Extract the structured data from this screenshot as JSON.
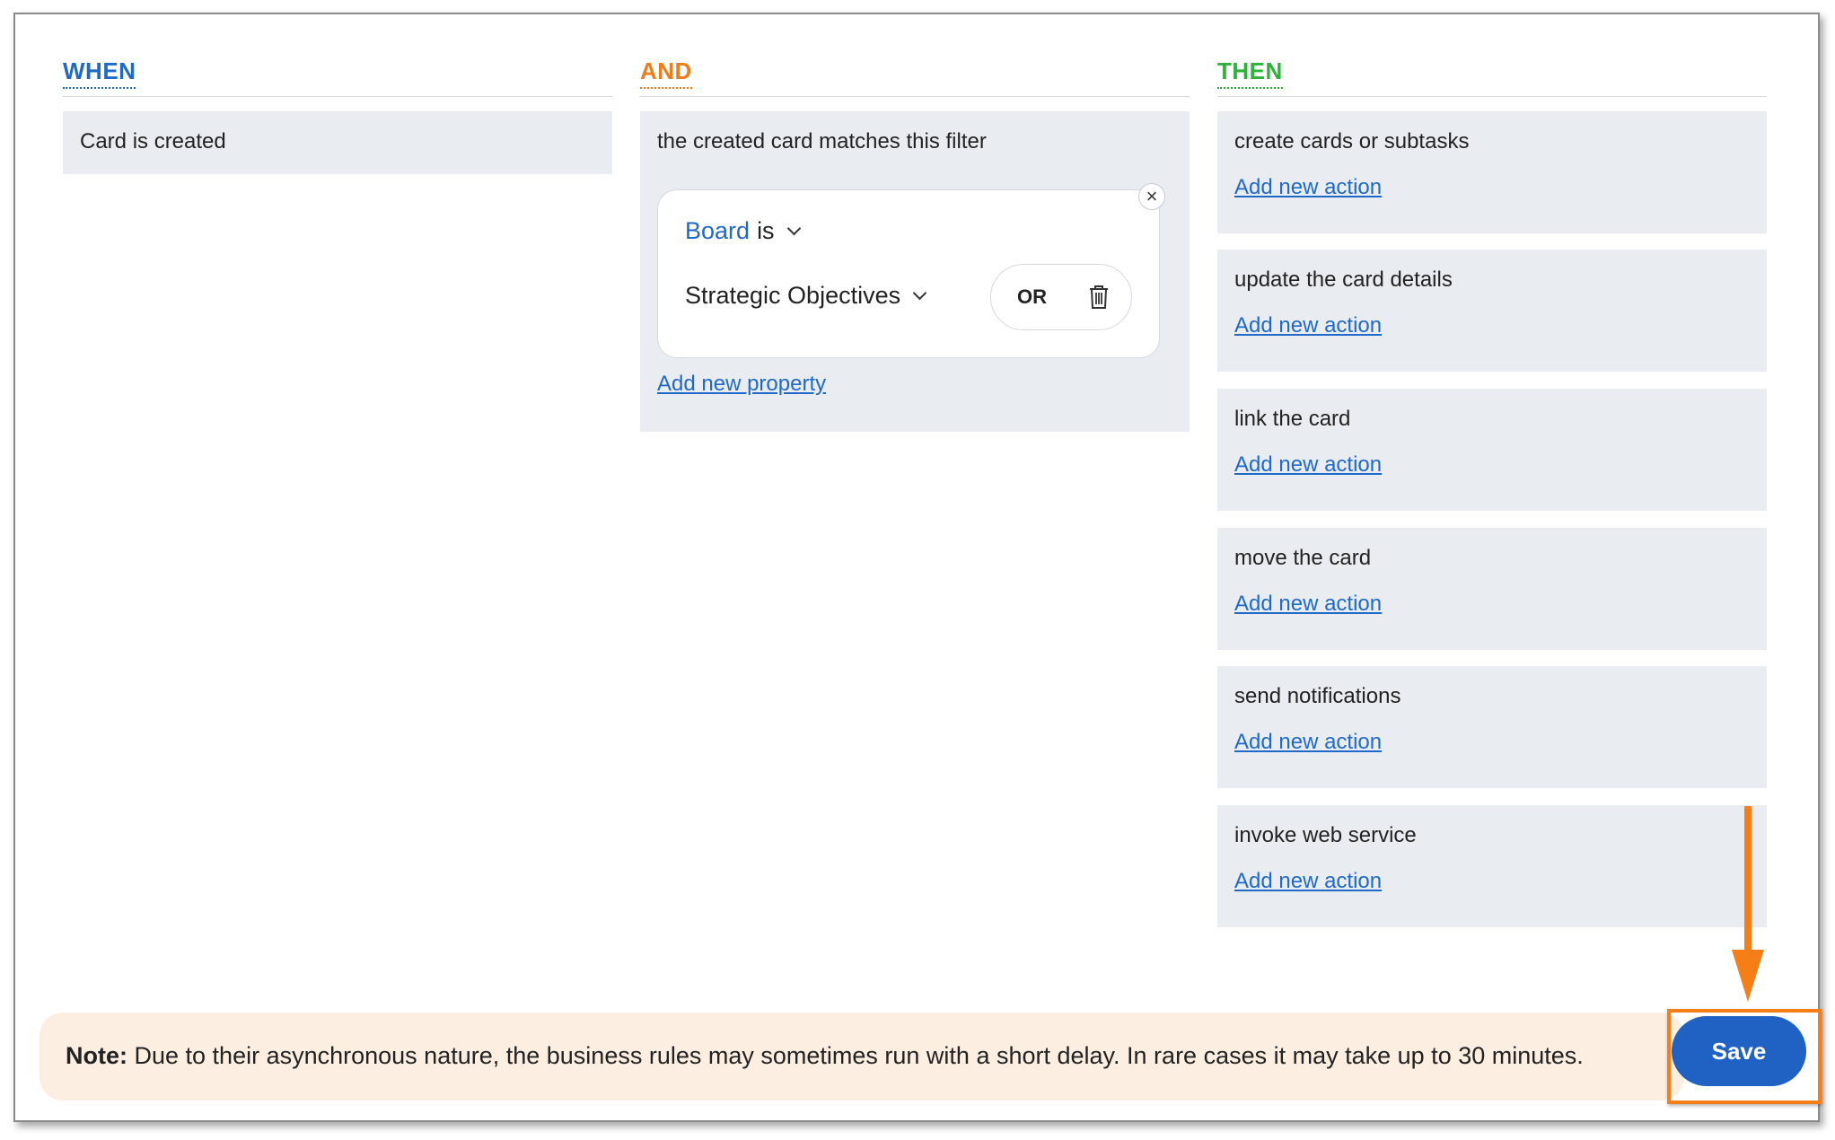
{
  "when": {
    "title": "WHEN",
    "trigger": "Card is created"
  },
  "and": {
    "title": "AND",
    "condition": "the created card matches this filter",
    "filter": {
      "property": "Board",
      "operator": "is",
      "value": "Strategic Objectives",
      "or_label": "OR",
      "close_symbol": "×"
    },
    "add_property_label": "Add new property"
  },
  "then": {
    "title": "THEN",
    "actions": [
      {
        "label": "create cards or subtasks",
        "link": "Add new action"
      },
      {
        "label": "update the card details",
        "link": "Add new action"
      },
      {
        "label": "link the card",
        "link": "Add new action"
      },
      {
        "label": "move the card",
        "link": "Add new action"
      },
      {
        "label": "send notifications",
        "link": "Add new action"
      },
      {
        "label": "invoke web service",
        "link": "Add new action"
      }
    ]
  },
  "note": {
    "label": "Note:",
    "text": " Due to their asynchronous nature, the business rules may sometimes run with a short delay. In rare cases it may take up to 30 minutes."
  },
  "save_label": "Save",
  "colors": {
    "when": "#1f69c8",
    "and": "#f07c1a",
    "then": "#2eb23a",
    "primary_button": "#1f62c4",
    "highlight": "#f57e16",
    "panel_bg": "#e9edf1",
    "note_bg": "#fdeee2"
  },
  "icons": [
    "close-icon",
    "chevron-down-icon",
    "trash-icon",
    "arrow-down-annotation"
  ]
}
